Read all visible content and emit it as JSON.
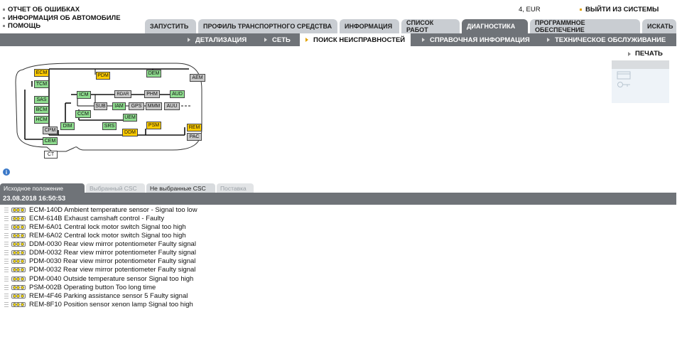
{
  "top_links": [
    "ОТЧЕТ ОБ ОШИБКАХ",
    "ИНФОРМАЦИЯ ОБ АВТОМОБИЛЕ",
    "ПОМОЩЬ"
  ],
  "currency": "4, EUR",
  "logout": "ВЫЙТИ ИЗ СИСТЕМЫ",
  "main_tabs": [
    "ЗАПУСТИТЬ",
    "ПРОФИЛЬ ТРАНСПОРТНОГО СРЕДСТВА",
    "ИНФОРМАЦИЯ",
    "СПИСОК РАБОТ",
    "ДИАГНОСТИКА",
    "ПРОГРАММНОЕ ОБЕСПЕЧЕНИЕ",
    "ИСКАТЬ"
  ],
  "sub_nav": [
    "ДЕТАЛИЗАЦИЯ",
    "СЕТЬ",
    "ПОИСК НЕИСПРАВНОСТЕЙ",
    "СПРАВОЧНАЯ ИНФОРМАЦИЯ",
    "ТЕХНИЧЕСКОЕ ОБСЛУЖИВАНИЕ"
  ],
  "print_label": "ПЕЧАТЬ",
  "modules": {
    "ecm": "ECM",
    "tcm": "TCM",
    "sas": "SAS",
    "bcm": "BCM",
    "hcm": "HCM",
    "cpm": "CPM",
    "cem": "CEM",
    "ct": "CT",
    "dim": "DIM",
    "pdm": "PDM",
    "dem": "DEM",
    "aem": "AEM",
    "icm": "ICM",
    "rdar": "RDAR",
    "phm": "PHM",
    "aud": "AUD",
    "sub": "SUB",
    "iam": "IAM",
    "gps": "GPS",
    "mmm": "MMM",
    "auu": "AUU",
    "ccm": "CCM",
    "uem": "UEM",
    "srs": "SRS",
    "ddm": "DDM",
    "psm": "PSM",
    "rem": "REM",
    "pac": "PAC"
  },
  "colors": {
    "ok": "#8fdc8f",
    "fault": "#ffcc00",
    "not_found": "#c8c8c8",
    "nav": "#6f7378"
  },
  "info_icon": "i",
  "result_tabs": [
    "Исходное положение",
    "Выбранный CSC",
    "Не выбранные CSC",
    "Поставка"
  ],
  "datetime": "23.08.2018 16:50:53",
  "dtcs": [
    "ECM-140D Ambient temperature sensor - Signal too low",
    "ECM-614B Exhaust camshaft control - Faulty",
    "REM-6A01 Central lock motor switch Signal too high",
    "REM-6A02 Central lock motor switch Signal too high",
    "DDM-0030 Rear view mirror potentiometer Faulty signal",
    "DDM-0032 Rear view mirror potentiometer Faulty signal",
    "PDM-0030 Rear view mirror potentiometer Faulty signal",
    "PDM-0032 Rear view mirror potentiometer Faulty signal",
    "PDM-0040 Outside temperature sensor Signal too high",
    "PSM-002B Operating button Too long time",
    "REM-4F46 Parking assistance sensor 5 Faulty signal",
    "REM-8F10 Position sensor xenon lamp Signal too high"
  ]
}
